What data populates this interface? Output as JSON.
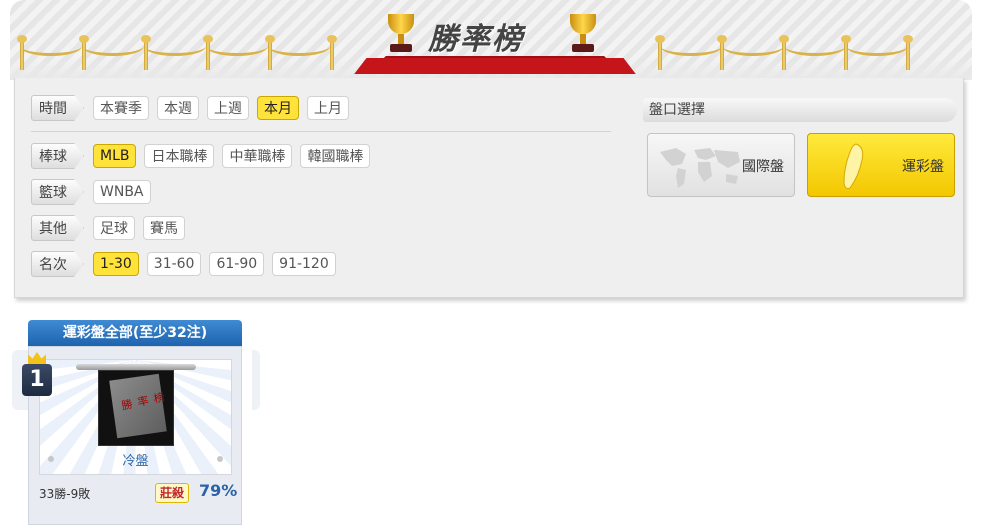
{
  "header": {
    "title": "勝率榜"
  },
  "filters": {
    "time": {
      "label": "時間",
      "options": [
        "本賽季",
        "本週",
        "上週",
        "本月",
        "上月"
      ],
      "selected": 3
    },
    "baseball": {
      "label": "棒球",
      "options": [
        "MLB",
        "日本職棒",
        "中華職棒",
        "韓國職棒"
      ],
      "selected": 0
    },
    "basketball": {
      "label": "籃球",
      "options": [
        "WNBA"
      ],
      "selected": -1
    },
    "other": {
      "label": "其他",
      "options": [
        "足球",
        "賽馬"
      ],
      "selected": -1
    },
    "rank": {
      "label": "名次",
      "options": [
        "1-30",
        "31-60",
        "61-90",
        "91-120"
      ],
      "selected": 0
    }
  },
  "market": {
    "header": "盤口選擇",
    "international": "國際盤",
    "lottery": "運彩盤",
    "selected": "lottery"
  },
  "ranking": {
    "title": "運彩盤全部(至少32注)",
    "entries": [
      {
        "rank": "1",
        "name": "冷盤",
        "record": "33勝-9敗",
        "badge": "莊殺",
        "win_rate": "79%"
      }
    ]
  },
  "colors": {
    "selected": "#ffe23a",
    "card_header": "#1e63ad",
    "accent_text": "#2a63a8"
  }
}
